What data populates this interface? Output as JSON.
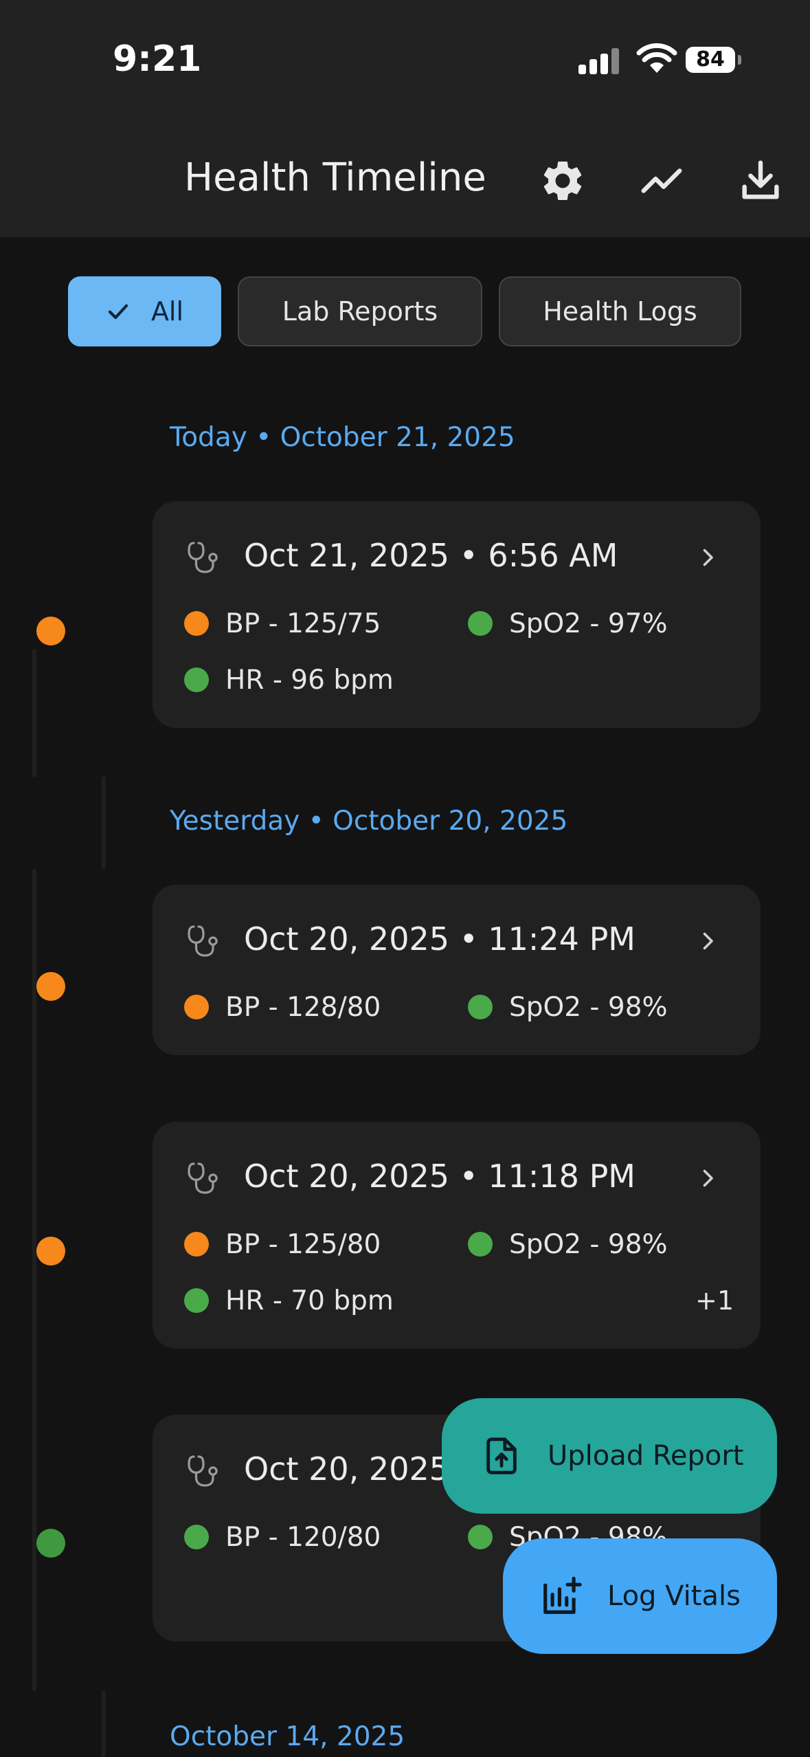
{
  "status_bar": {
    "time": "9:21",
    "battery": "84"
  },
  "header": {
    "title": "Health Timeline",
    "icons": [
      "gear-icon",
      "trend-chart-icon",
      "download-icon"
    ]
  },
  "filters": [
    {
      "label": "All",
      "selected": true
    },
    {
      "label": "Lab Reports",
      "selected": false
    },
    {
      "label": "Health Logs",
      "selected": false
    }
  ],
  "sections": [
    {
      "label": "Today • October 21, 2025"
    },
    {
      "label": "Yesterday • October 20, 2025"
    },
    {
      "label": "October 14, 2025"
    }
  ],
  "entries": [
    {
      "title": "Oct 21, 2025 • 6:56 AM",
      "status_color": "#f7881b",
      "vitals": [
        {
          "label": "BP - 125/75",
          "color": "#f7881b"
        },
        {
          "label": "SpO2 - 97%",
          "color": "#4aaa4a"
        },
        {
          "label": "HR - 96 bpm",
          "color": "#4aaa4a"
        }
      ]
    },
    {
      "title": "Oct 20, 2025 • 11:24 PM",
      "status_color": "#f7881b",
      "vitals": [
        {
          "label": "BP - 128/80",
          "color": "#f7881b"
        },
        {
          "label": "SpO2 - 98%",
          "color": "#4aaa4a"
        }
      ]
    },
    {
      "title": "Oct 20, 2025 • 11:18 PM",
      "status_color": "#f7881b",
      "vitals": [
        {
          "label": "BP - 125/80",
          "color": "#f7881b"
        },
        {
          "label": "SpO2 - 98%",
          "color": "#4aaa4a"
        },
        {
          "label": "HR - 70 bpm",
          "color": "#4aaa4a"
        }
      ],
      "more": "+1"
    },
    {
      "title": "Oct 20, 2025",
      "status_color": "#3f9a3f",
      "vitals": [
        {
          "label": "BP - 120/80",
          "color": "#4aaa4a"
        },
        {
          "label": "SpO2 - 98%",
          "color": "#4aaa4a"
        }
      ]
    }
  ],
  "fabs": {
    "upload": {
      "label": "Upload Report",
      "icon": "upload-file-icon",
      "color": "#26a59a"
    },
    "log_vitals": {
      "label": "Log Vitals",
      "icon": "add-chart-icon",
      "color": "#43a7f5"
    }
  },
  "colors": {
    "accent": "#5aaaf0",
    "warning": "#f7881b",
    "normal": "#4aaa4a",
    "background": "#131313",
    "card": "#212121"
  }
}
